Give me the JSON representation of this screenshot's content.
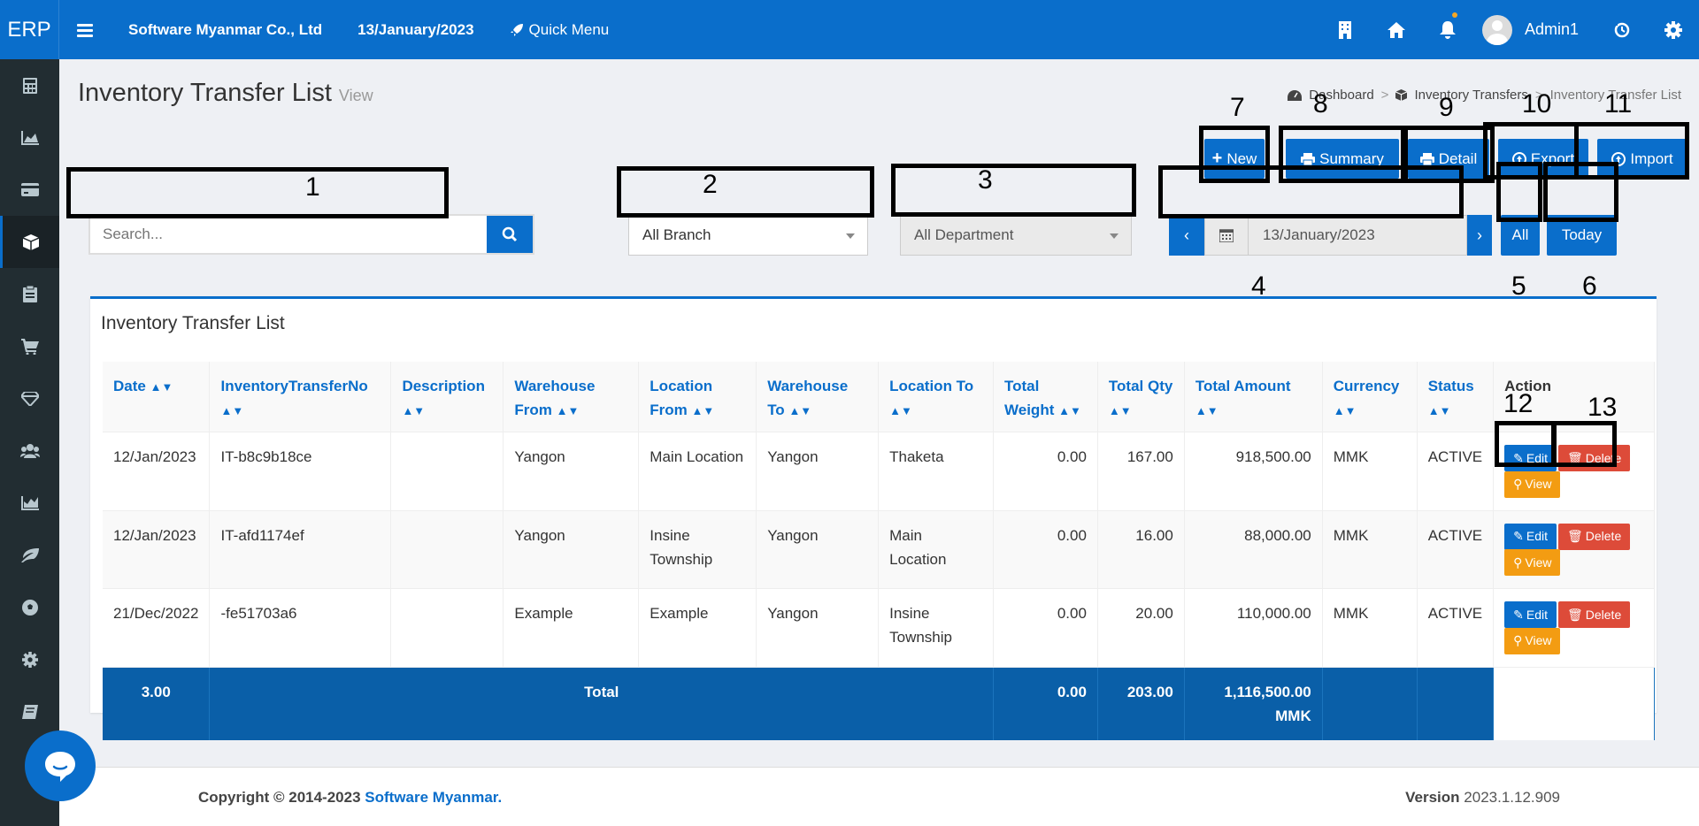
{
  "topbar": {
    "brand": "ERP",
    "company": "Software Myanmar Co., Ltd",
    "date": "13/January/2023",
    "quick_menu": "Quick Menu",
    "user": "Admin1"
  },
  "page": {
    "title": "Inventory Transfer List",
    "subtitle": "View",
    "breadcrumb": [
      "Dashboard",
      "Inventory Transfers",
      "Inventory Transfer List"
    ]
  },
  "toolbar": {
    "new": "New",
    "summary": "Summary",
    "detail": "Detail",
    "export": "Export",
    "import": "Import"
  },
  "filters": {
    "search_placeholder": "Search...",
    "branch": "All Branch",
    "department": "All Department",
    "date": "13/January/2023",
    "all": "All",
    "today": "Today"
  },
  "panel": {
    "title": "Inventory Transfer List"
  },
  "table": {
    "headers": [
      "Date",
      "InventoryTransferNo",
      "Description",
      "Warehouse From",
      "Location From",
      "Warehouse To",
      "Location To",
      "Total Weight",
      "Total Qty",
      "Total Amount",
      "Currency",
      "Status",
      "Action"
    ],
    "rows": [
      [
        "12/Jan/2023",
        "IT-b8c9b18ce",
        "",
        "Yangon",
        "Main Location",
        "Yangon",
        "Thaketa",
        "0.00",
        "167.00",
        "918,500.00",
        "MMK",
        "ACTIVE"
      ],
      [
        "12/Jan/2023",
        "IT-afd1174ef",
        "",
        "Yangon",
        "Insine Township",
        "Yangon",
        "Main Location",
        "0.00",
        "16.00",
        "88,000.00",
        "MMK",
        "ACTIVE"
      ],
      [
        "21/Dec/2022",
        "-fe51703a6",
        "",
        "Example",
        "Example",
        "Yangon",
        "Insine Township",
        "0.00",
        "20.00",
        "110,000.00",
        "MMK",
        "ACTIVE"
      ]
    ],
    "actions": {
      "edit": "Edit",
      "delete": "Delete",
      "view": "View"
    },
    "total": {
      "count": "3.00",
      "label": "Total",
      "weight": "0.00",
      "qty": "203.00",
      "amount": "1,116,500.00 MMK"
    }
  },
  "annotations": [
    "1",
    "2",
    "3",
    "4",
    "5",
    "6",
    "7",
    "8",
    "9",
    "10",
    "11",
    "12",
    "13"
  ],
  "footer": {
    "copyright": "Copyright © 2014-2023 ",
    "company": "Software Myanmar.",
    "version_label": "Version",
    "version": "2023.1.12.909"
  },
  "colors": {
    "primary": "#0a6ecb",
    "sidebar": "#222d32",
    "danger": "#dd4b39",
    "warning": "#f39c12"
  }
}
